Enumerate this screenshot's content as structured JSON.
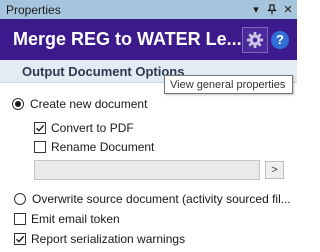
{
  "panel": {
    "title": "Properties",
    "pin_icon": "pin-icon",
    "close_icon": "close-icon",
    "dropdown_icon": "dropdown-arrow-icon"
  },
  "header": {
    "title": "Merge REG to WATER Le...",
    "settings_icon": "gear-icon",
    "help_label": "?",
    "background": "#3c1a8c"
  },
  "section": {
    "title": "Output Document Options"
  },
  "tooltip": {
    "text": "View general properties"
  },
  "options": {
    "create_new": {
      "label": "Create new document",
      "selected": true
    },
    "convert_pdf": {
      "label": "Convert to PDF",
      "checked": true
    },
    "rename": {
      "label": "Rename Document",
      "checked": false
    },
    "rename_value": "",
    "browse_label": ">",
    "overwrite": {
      "label": "Overwrite source document (activity sourced fil...",
      "selected": false
    },
    "emit_email": {
      "label": "Emit email token",
      "checked": false
    },
    "report_warnings": {
      "label": "Report serialization warnings",
      "checked": true
    }
  }
}
